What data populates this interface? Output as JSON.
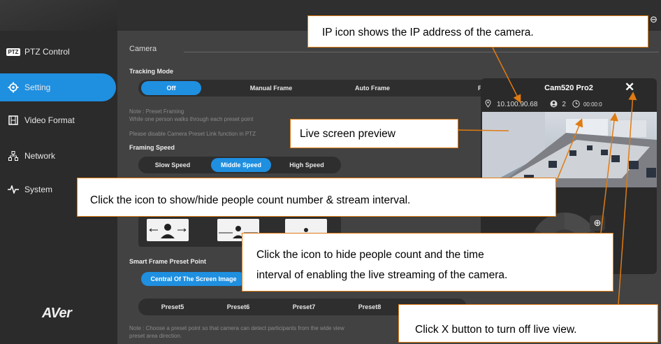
{
  "sidebar": {
    "items": [
      {
        "label": "PTZ Control",
        "icon": "ptz-icon",
        "badge": "PTZ"
      },
      {
        "label": "Setting",
        "icon": "gear-icon"
      },
      {
        "label": "Video Format",
        "icon": "film-icon"
      },
      {
        "label": "Network",
        "icon": "network-icon"
      },
      {
        "label": "System",
        "icon": "pulse-icon"
      }
    ],
    "logo": "AVer"
  },
  "camera": {
    "section_title": "Camera",
    "tracking_mode_label": "Tracking Mode",
    "tracking_buttons": [
      "Off",
      "Manual Frame",
      "Auto Frame",
      "Preset Fr"
    ],
    "note_title": "Note : Preset Framing",
    "note_line1": "While one person walks through each preset point",
    "note_line2": "Please disable Camera Preset Link function in PTZ",
    "framing_speed_label": "Framing Speed",
    "speed_buttons": [
      "Slow Speed",
      "Middle Speed",
      "High Speed"
    ],
    "smart_frame_label": "Smart Frame Preset Point",
    "smart_frame_value": "Central Of The Screen Image",
    "preset_buttons": [
      "Preset5",
      "Preset6",
      "Preset7",
      "Preset8"
    ],
    "bottom_note_line1": "Note : Choose a preset point so that camera can detect participants from the wide view",
    "bottom_note_line2": "preset area direction."
  },
  "preview": {
    "title": "Cam520 Pro2",
    "ip": "10.100.90.68",
    "people_count": "2",
    "time": "00:00:0"
  },
  "callouts": {
    "ip": "IP icon shows the IP address of the camera.",
    "live": "Live screen preview",
    "toggle": "Click the icon to show/hide people count number & stream interval.",
    "hide_line1": "Click the icon to hide people count and the time",
    "hide_line2": "interval of enabling the live streaming of the camera.",
    "close": "Click X button to turn off live view."
  },
  "colors": {
    "accent": "#1f8fe0",
    "callout_border": "#e07b12",
    "arrow": "#e07b12"
  }
}
